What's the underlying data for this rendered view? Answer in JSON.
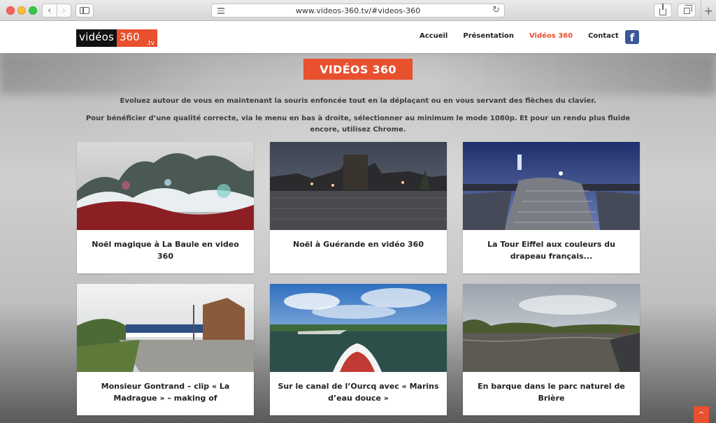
{
  "browser": {
    "url": "www.videos-360.tv/#videos-360",
    "back_icon": "‹",
    "forward_icon": "›",
    "reload_icon": "↻",
    "newtab_icon": "+"
  },
  "site": {
    "logo": {
      "left": "vidéos",
      "right": "360",
      "suffix": ".tv"
    },
    "nav": [
      {
        "label": "Accueil"
      },
      {
        "label": "Présentation"
      },
      {
        "label": "Vidéos 360"
      },
      {
        "label": "Contact"
      }
    ],
    "facebook_icon": "f",
    "accent_color": "#e8502e"
  },
  "main": {
    "title": "VIDÉOS 360",
    "intro_line1": "Evoluez autour de vous en maintenant la souris enfoncée tout en la déplaçant ou en vous servant des flèches du clavier.",
    "intro_line2": "Pour bénéficier d’une qualité correcte, via le menu en bas à droite, sélectionner au minimum le mode 1080p. Et pour un rendu plus fluide encore, utilisez Chrome."
  },
  "cards": [
    {
      "title": "Noël magique à La Baule en video 360"
    },
    {
      "title": "Noël à Guérande en vidéo 360"
    },
    {
      "title": "La Tour Eiffel aux couleurs du drapeau français..."
    },
    {
      "title": "Monsieur Gontrand – clip « La Madrague » – making of"
    },
    {
      "title": "Sur le canal de l’Ourcq avec « Marins d’eau douce »"
    },
    {
      "title": "En barque dans le parc naturel de Brière"
    }
  ],
  "scroll_top_icon": "^"
}
